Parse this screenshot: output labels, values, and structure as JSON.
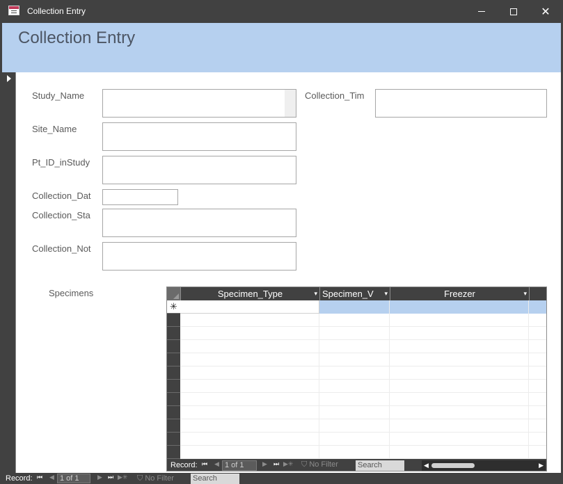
{
  "window": {
    "title": "Collection Entry",
    "minimize_icon": "minimize-icon",
    "maximize_icon": "maximize-icon",
    "close_glyph": "✕"
  },
  "form": {
    "header_title": "Collection Entry",
    "fields": [
      {
        "label": "Study_Name",
        "value": ""
      },
      {
        "label": "Collection_Tim",
        "value": ""
      },
      {
        "label": "Site_Name",
        "value": ""
      },
      {
        "label": "Pt_ID_inStudy",
        "value": ""
      },
      {
        "label": "Collection_Dat",
        "value": ""
      },
      {
        "label": "Collection_Sta",
        "value": ""
      },
      {
        "label": "Collection_Not",
        "value": ""
      }
    ],
    "subform_label": "Specimens"
  },
  "subform": {
    "columns": [
      {
        "label": "Specimen_Type",
        "dropdown": "▾"
      },
      {
        "label": "Specimen_V",
        "dropdown": "▾"
      },
      {
        "label": "Freezer",
        "dropdown": "▾"
      }
    ],
    "new_record_glyph": "✳",
    "nav": {
      "record_label": "Record:",
      "first": "⏮",
      "prev": "◀",
      "position": "1 of 1",
      "next": "▶",
      "last": "⏭",
      "new": "▶✳",
      "filter": "No Filter",
      "search": "Search",
      "scroll_left": "◀",
      "scroll_right": "▶"
    }
  },
  "main_nav": {
    "record_label": "Record:",
    "first": "⏮",
    "prev": "◀",
    "position": "1 of 1",
    "next": "▶",
    "last": "⏭",
    "new": "▶✳",
    "filter": "No Filter",
    "search": "Search"
  },
  "colors": {
    "header_band": "#b6d0ef",
    "chrome_dark": "#414141",
    "selection": "#b6d0ef"
  }
}
